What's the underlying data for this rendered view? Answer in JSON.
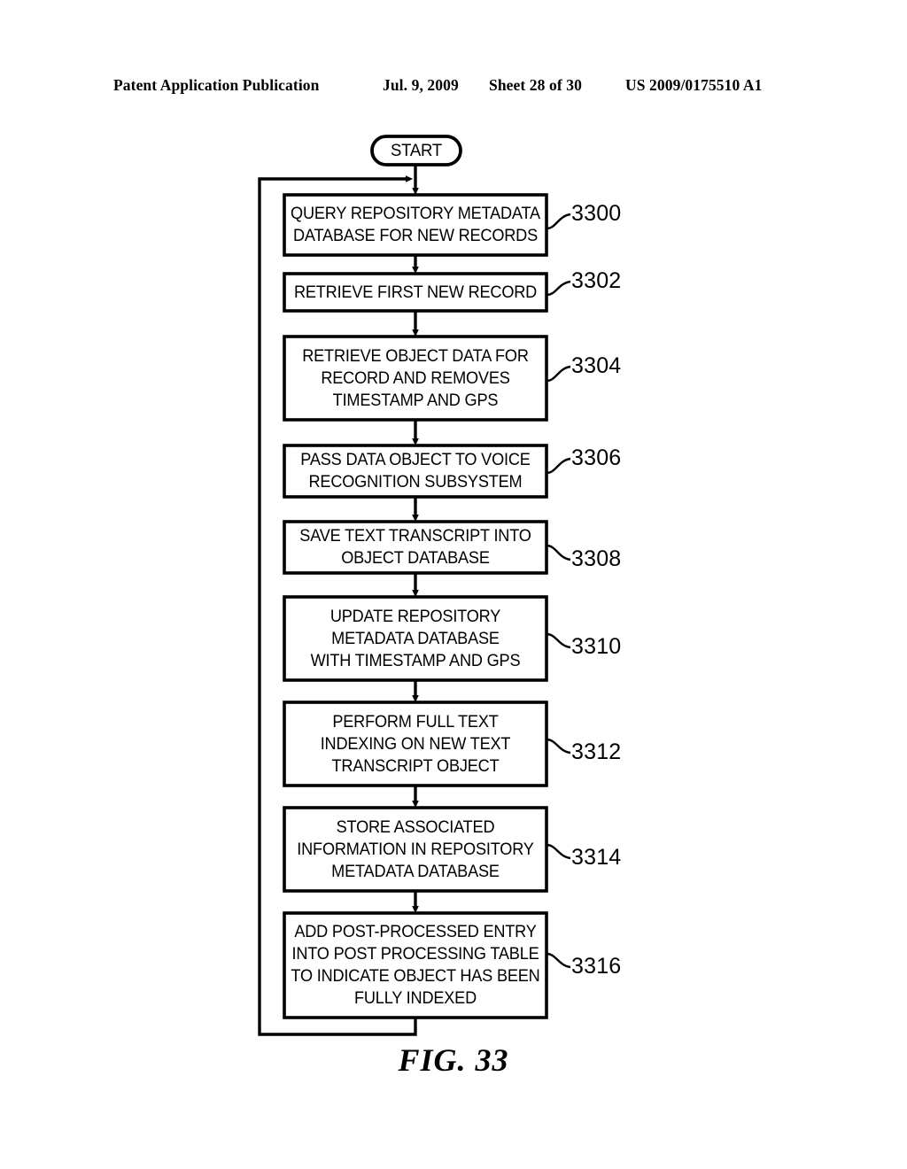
{
  "header": {
    "publication": "Patent Application Publication",
    "date": "Jul. 9, 2009",
    "sheet": "Sheet 28 of 30",
    "patent_number": "US 2009/0175510 A1"
  },
  "figure": {
    "caption": "FIG. 33",
    "start_label": "START"
  },
  "chart_data": {
    "type": "diagram",
    "title": "FIG. 33",
    "diagram_kind": "flowchart",
    "orientation": "top-to-bottom",
    "terminal": {
      "id": "start",
      "label": "START",
      "shape": "stadium"
    },
    "nodes": [
      {
        "ref": "3300",
        "shape": "rectangle",
        "lines": [
          "QUERY REPOSITORY METADATA",
          "DATABASE FOR NEW RECORDS"
        ],
        "callout": "up"
      },
      {
        "ref": "3302",
        "shape": "rectangle",
        "lines": [
          "RETRIEVE FIRST NEW RECORD"
        ],
        "callout": "up"
      },
      {
        "ref": "3304",
        "shape": "rectangle",
        "lines": [
          "RETRIEVE OBJECT DATA FOR",
          "RECORD AND REMOVES",
          "TIMESTAMP AND GPS"
        ],
        "callout": "up"
      },
      {
        "ref": "3306",
        "shape": "rectangle",
        "lines": [
          "PASS DATA OBJECT TO VOICE",
          "RECOGNITION SUBSYSTEM"
        ],
        "callout": "up"
      },
      {
        "ref": "3308",
        "shape": "rectangle",
        "lines": [
          "SAVE TEXT TRANSCRIPT INTO",
          "OBJECT DATABASE"
        ],
        "callout": "down"
      },
      {
        "ref": "3310",
        "shape": "rectangle",
        "lines": [
          "UPDATE REPOSITORY",
          "METADATA DATABASE",
          "WITH TIMESTAMP AND GPS"
        ],
        "callout": "down"
      },
      {
        "ref": "3312",
        "shape": "rectangle",
        "lines": [
          "PERFORM FULL TEXT",
          "INDEXING ON NEW TEXT",
          "TRANSCRIPT OBJECT"
        ],
        "callout": "down"
      },
      {
        "ref": "3314",
        "shape": "rectangle",
        "lines": [
          "STORE ASSOCIATED",
          "INFORMATION IN REPOSITORY",
          "METADATA DATABASE"
        ],
        "callout": "down"
      },
      {
        "ref": "3316",
        "shape": "rectangle",
        "lines": [
          "ADD POST-PROCESSED ENTRY",
          "INTO POST PROCESSING TABLE",
          "TO INDICATE OBJECT HAS BEEN",
          "FULLY INDEXED"
        ],
        "callout": "down"
      }
    ],
    "edges": [
      {
        "from": "start",
        "to": "3300",
        "arrow": true
      },
      {
        "from": "3300",
        "to": "3302",
        "arrow": true
      },
      {
        "from": "3302",
        "to": "3304",
        "arrow": true
      },
      {
        "from": "3304",
        "to": "3306",
        "arrow": true
      },
      {
        "from": "3306",
        "to": "3308",
        "arrow": true
      },
      {
        "from": "3308",
        "to": "3310",
        "arrow": true
      },
      {
        "from": "3310",
        "to": "3312",
        "arrow": true
      },
      {
        "from": "3312",
        "to": "3314",
        "arrow": true
      },
      {
        "from": "3314",
        "to": "3316",
        "arrow": true
      },
      {
        "from": "3316",
        "to": "3300",
        "arrow": true,
        "kind": "feedback-loop",
        "route": "bottom-left-up"
      }
    ],
    "colors": {
      "stroke": "#000000",
      "fill": "#ffffff",
      "text": "#000000"
    }
  }
}
